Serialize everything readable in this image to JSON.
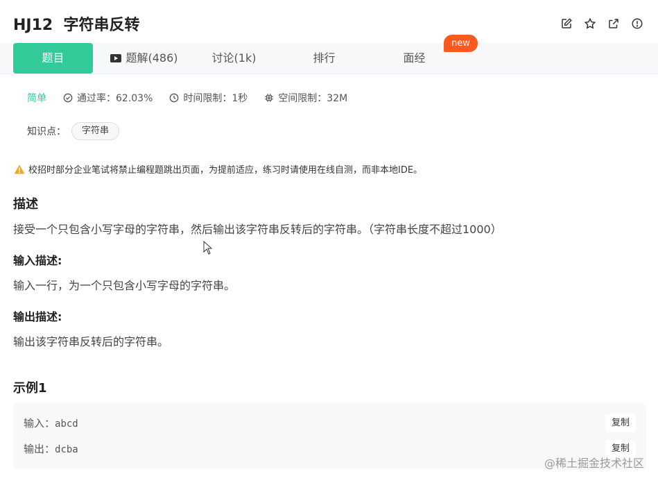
{
  "header": {
    "title": "HJ12  字符串反转",
    "icons": [
      "edit-icon",
      "star-icon",
      "external-link-icon",
      "info-icon"
    ]
  },
  "tabs": [
    {
      "label": "题目",
      "active": true
    },
    {
      "label": "题解(486)",
      "icon": "video-play-icon"
    },
    {
      "label": "讨论(1k)"
    },
    {
      "label": "排行"
    },
    {
      "label": "面经"
    }
  ],
  "new_badge": "new",
  "meta": {
    "difficulty": "简单",
    "pass_rate": "通过率：62.03%",
    "time_limit": "时间限制：1秒",
    "space_limit": "空间限制：32M"
  },
  "knowledge": {
    "label": "知识点：",
    "tag": "字符串"
  },
  "notice": "校招时部分企业笔试将禁止编程题跳出页面，为提前适应，练习时请使用在线自测，而非本地IDE。",
  "description": {
    "heading": "描述",
    "text": "接受一个只包含小写字母的字符串，然后输出该字符串反转后的字符串。（字符串长度不超过1000）"
  },
  "input_desc": {
    "heading": "输入描述:",
    "text": "输入一行，为一个只包含小写字母的字符串。"
  },
  "output_desc": {
    "heading": "输出描述:",
    "text": "输出该字符串反转后的字符串。"
  },
  "example": {
    "heading": "示例1",
    "input_label": "输入：",
    "input_value": "abcd",
    "output_label": "输出：",
    "output_value": "dcba",
    "copy_label": "复制"
  },
  "watermark": "@稀土掘金技术社区",
  "colors": {
    "accent": "#32ca99",
    "badge": "#fa5a1e",
    "warning": "#f5a623"
  }
}
